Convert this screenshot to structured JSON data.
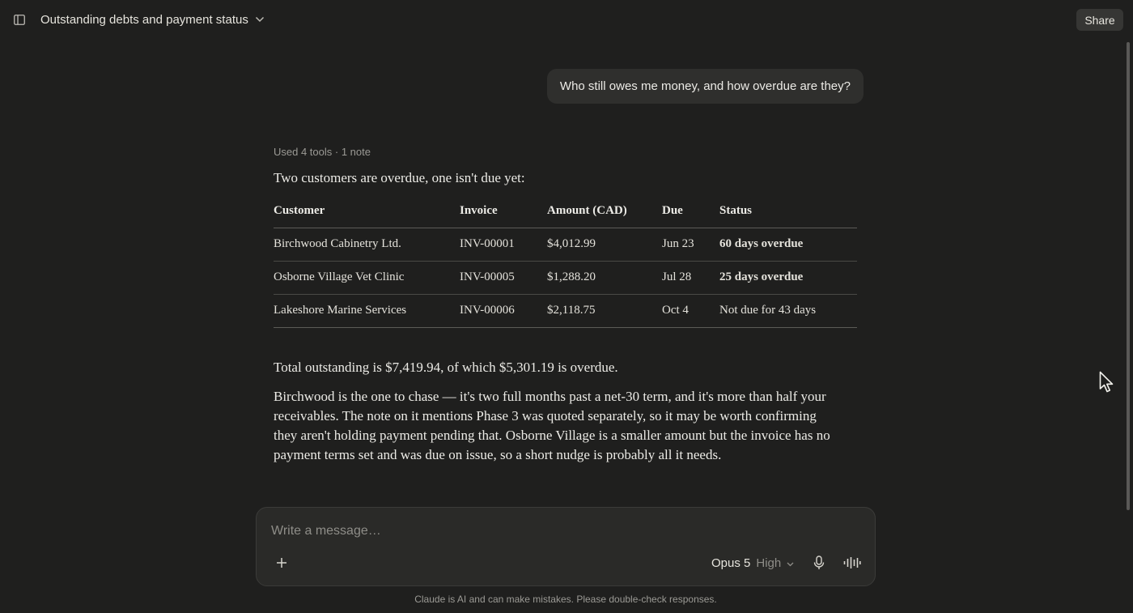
{
  "header": {
    "title": "Outstanding debts and payment status",
    "share_label": "Share",
    "icons": [
      "sidebar-toggle-icon",
      "chevron-down-icon"
    ]
  },
  "conversation": {
    "user_message": "Who still owes me money, and how overdue are they?",
    "tools_summary": "Used 4 tools · 1 note",
    "intro": "Two customers are overdue, one isn't due yet:",
    "table": {
      "headers": [
        "Customer",
        "Invoice",
        "Amount (CAD)",
        "Due",
        "Status"
      ],
      "rows": [
        [
          "Birchwood Cabinetry Ltd.",
          "INV-00001",
          "$4,012.99",
          "Jun 23",
          "60 days overdue"
        ],
        [
          "Osborne Village Vet Clinic",
          "INV-00005",
          "$1,288.20",
          "Jul 28",
          "25 days overdue"
        ],
        [
          "Lakeshore Marine Services",
          "INV-00006",
          "$2,118.75",
          "Oct 4",
          "Not due for 43 days"
        ]
      ]
    },
    "summary": "Total outstanding is $7,419.94, of which $5,301.19 is overdue.",
    "advice": "Birchwood is the one to chase — it's two full months past a net-30 term, and it's more than half your receivables. The note on it mentions Phase 3 was quoted separately, so it may be worth confirming they aren't holding payment pending that. Osborne Village is a smaller amount but the invoice has no payment terms set and was due on issue, so a short nudge is probably all it needs."
  },
  "composer": {
    "placeholder": "Write a message…",
    "model": "Opus 5",
    "effort": "High",
    "icons": [
      "plus-icon",
      "microphone-icon",
      "voice-waveform-icon"
    ]
  },
  "footer": {
    "disclaimer": "Claude is AI and can make mistakes. Please double-check responses."
  },
  "colors": {
    "background": "#1f1f1e",
    "bubble": "#2f2f2d",
    "composer": "#2a2a28",
    "text": "#ecebe6",
    "muted": "#9b9a95"
  }
}
